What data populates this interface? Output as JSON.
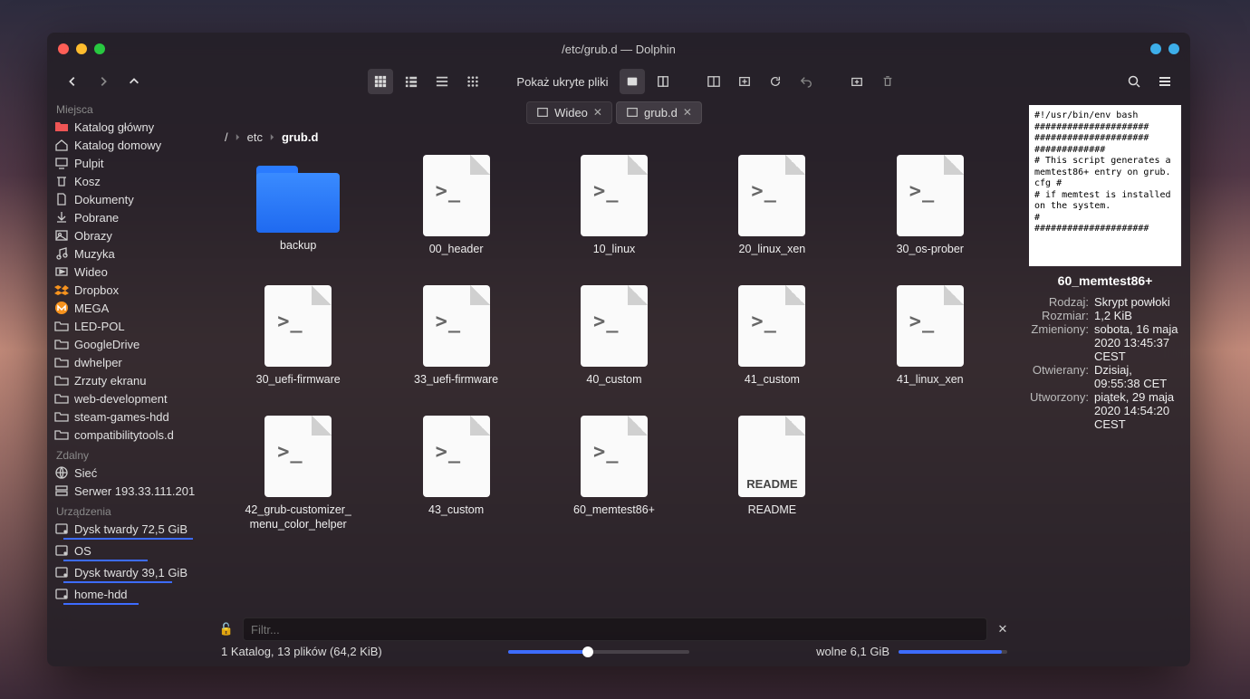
{
  "window": {
    "title": "/etc/grub.d — Dolphin"
  },
  "toolbar": {
    "show_hidden": "Pokaż ukryte pliki"
  },
  "tabs": [
    {
      "label": "Wideo",
      "active": false
    },
    {
      "label": "grub.d",
      "active": true
    }
  ],
  "breadcrumbs": {
    "root": "/",
    "parts": [
      "etc"
    ],
    "last": "grub.d"
  },
  "sidebar": {
    "sections": [
      {
        "title": "Miejsca",
        "items": [
          {
            "label": "Katalog główny",
            "icon": "folder-red"
          },
          {
            "label": "Katalog domowy",
            "icon": "home"
          },
          {
            "label": "Pulpit",
            "icon": "desktop"
          },
          {
            "label": "Kosz",
            "icon": "trash"
          },
          {
            "label": "Dokumenty",
            "icon": "doc"
          },
          {
            "label": "Pobrane",
            "icon": "download"
          },
          {
            "label": "Obrazy",
            "icon": "image"
          },
          {
            "label": "Muzyka",
            "icon": "music"
          },
          {
            "label": "Wideo",
            "icon": "video"
          },
          {
            "label": "Dropbox",
            "icon": "dropbox"
          },
          {
            "label": "MEGA",
            "icon": "mega"
          },
          {
            "label": "LED-POL",
            "icon": "folder"
          },
          {
            "label": "GoogleDrive",
            "icon": "folder"
          },
          {
            "label": "dwhelper",
            "icon": "folder"
          },
          {
            "label": "Zrzuty ekranu",
            "icon": "folder"
          },
          {
            "label": "web-development",
            "icon": "folder"
          },
          {
            "label": "steam-games-hdd",
            "icon": "folder"
          },
          {
            "label": "compatibilitytools.d",
            "icon": "folder"
          }
        ]
      },
      {
        "title": "Zdalny",
        "items": [
          {
            "label": "Sieć",
            "icon": "globe"
          },
          {
            "label": "Serwer 193.33.111.201",
            "icon": "server"
          }
        ]
      },
      {
        "title": "Urządzenia",
        "items": [
          {
            "label": "Dysk twardy 72,5 GiB",
            "icon": "disk",
            "gauge": 0.95
          },
          {
            "label": "OS",
            "icon": "disk",
            "gauge": 0.62
          },
          {
            "label": "Dysk twardy 39,1 GiB",
            "icon": "disk",
            "gauge": 0.8
          },
          {
            "label": "home-hdd",
            "icon": "disk",
            "gauge": 0.55
          }
        ]
      }
    ]
  },
  "files": [
    {
      "name": "backup",
      "type": "folder"
    },
    {
      "name": "00_header",
      "type": "sh"
    },
    {
      "name": "10_linux",
      "type": "sh"
    },
    {
      "name": "20_linux_xen",
      "type": "sh"
    },
    {
      "name": "30_os-prober",
      "type": "sh"
    },
    {
      "name": "30_uefi-firmware",
      "type": "sh"
    },
    {
      "name": "33_uefi-firmware",
      "type": "sh"
    },
    {
      "name": "40_custom",
      "type": "sh"
    },
    {
      "name": "41_custom",
      "type": "sh"
    },
    {
      "name": "41_linux_xen",
      "type": "sh"
    },
    {
      "name": "42_grub-customizer_\nmenu_color_helper",
      "type": "sh"
    },
    {
      "name": "43_custom",
      "type": "sh"
    },
    {
      "name": "60_memtest86+",
      "type": "sh"
    },
    {
      "name": "README",
      "type": "readme"
    }
  ],
  "filter": {
    "placeholder": "Filtr..."
  },
  "status": {
    "summary": "1 Katalog, 13 plików (64,2 KiB)",
    "free": "wolne 6,1 GiB"
  },
  "info": {
    "preview": "#!/usr/bin/env bash\n#####################\n#####################\n#############\n# This script generates a memtest86+ entry on grub.cfg #\n# if memtest is installed on the system.\n#\n#####################",
    "name": "60_memtest86+",
    "rows": [
      {
        "k": "Rodzaj:",
        "v": "Skrypt powłoki"
      },
      {
        "k": "Rozmiar:",
        "v": "1,2 KiB"
      },
      {
        "k": "Zmieniony:",
        "v": "sobota, 16 maja 2020 13:45:37 CEST"
      },
      {
        "k": "Otwierany:",
        "v": "Dzisiaj, 09:55:38 CET"
      },
      {
        "k": "Utworzony:",
        "v": "piątek, 29 maja 2020 14:54:20 CEST"
      }
    ]
  }
}
